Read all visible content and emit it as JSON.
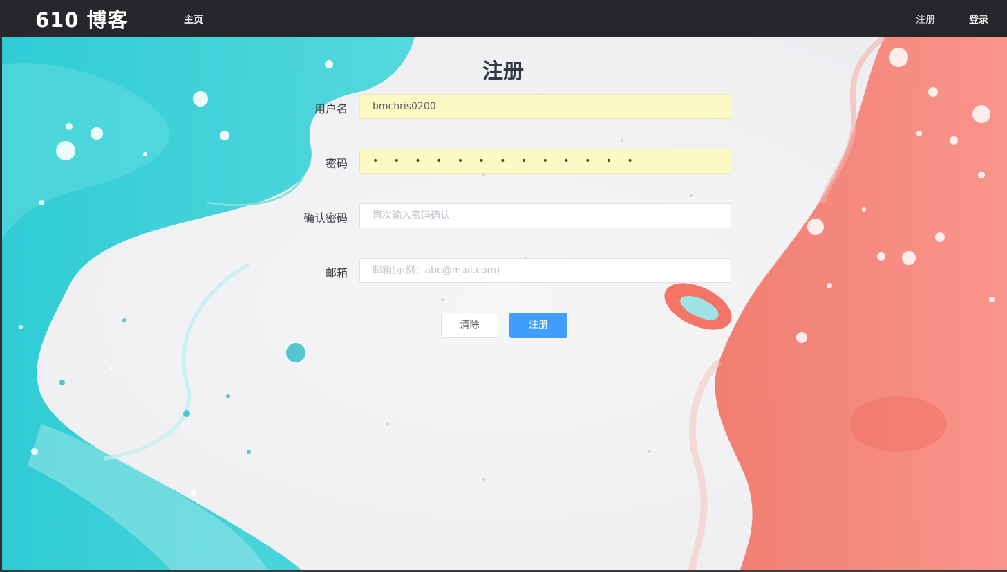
{
  "navbar": {
    "brand": "610 博客",
    "home": "主页",
    "register": "注册",
    "login": "登录"
  },
  "form": {
    "title": "注册",
    "username": {
      "label": "用户名",
      "value": "bmchris0200"
    },
    "password": {
      "label": "密码",
      "masked": "• • • • • • • • • • • • •"
    },
    "confirm": {
      "label": "确认密码",
      "placeholder": "再次输入密码确认"
    },
    "email": {
      "label": "邮箱",
      "placeholder": "邮箱(示例：abc@mail.com)"
    },
    "clear_label": "清除",
    "submit_label": "注册"
  },
  "colors": {
    "navbar": "#25272b",
    "accent": "#409eff",
    "autofill": "#fdf9c4",
    "teal": "#2fd0d6",
    "coral": "#f47f73"
  }
}
